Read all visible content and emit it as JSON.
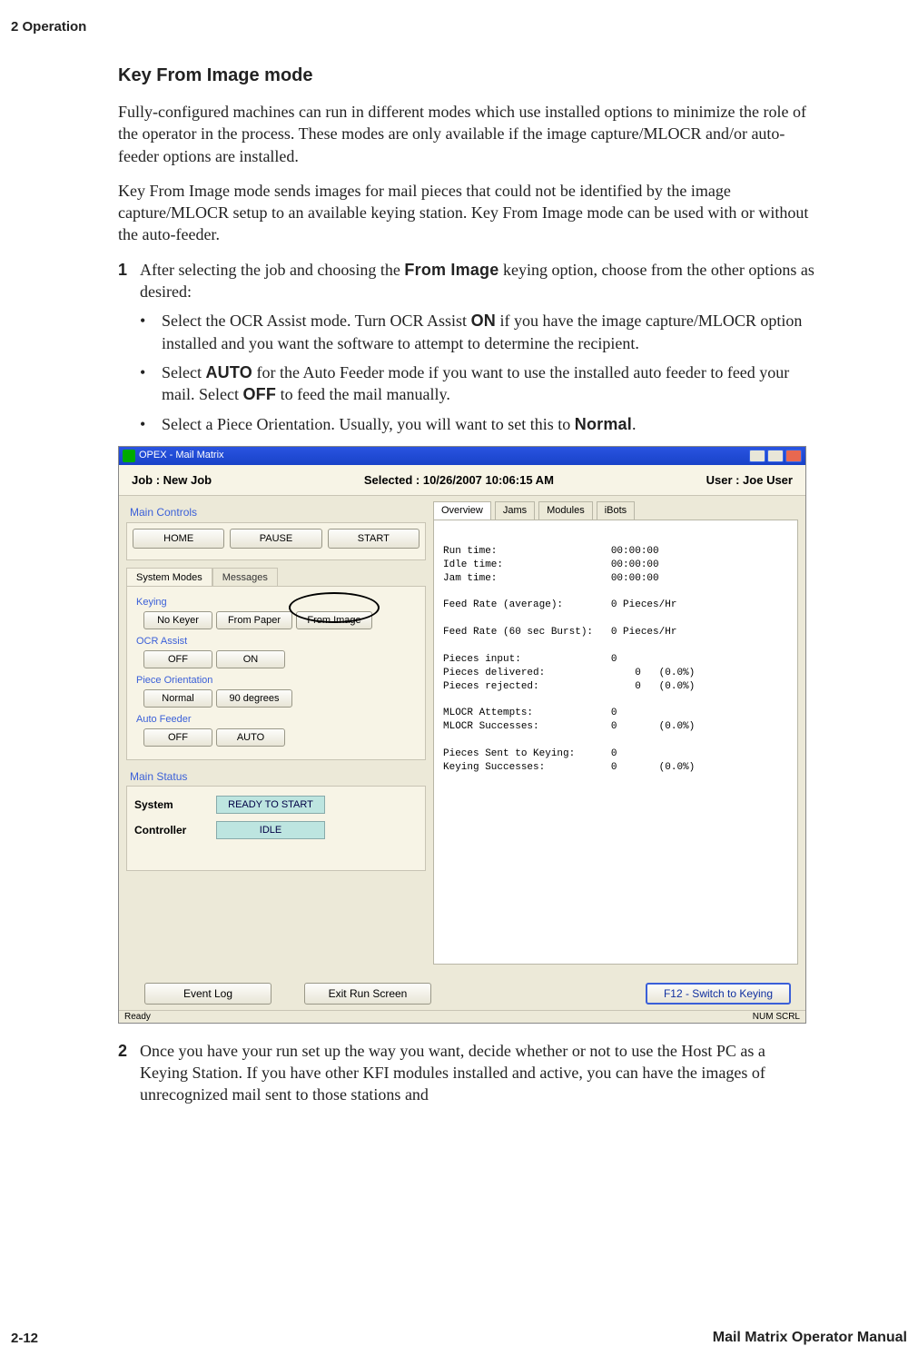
{
  "header": {
    "chapter": "2  Operation"
  },
  "section": {
    "title": "Key From Image mode"
  },
  "p1": "Fully-configured machines can run in different modes which use installed options to minimize the role of the operator in the process. These modes are only available if the image capture/MLOCR and/or auto-feeder options are installed.",
  "p2": "Key From Image mode sends images for mail pieces that could not be identified by the image capture/MLOCR setup to an available keying station. Key From Image mode can be used with or without the auto-feeder.",
  "step1": {
    "num": "1",
    "text_a": "After selecting the job and choosing the ",
    "term_a": "From Image",
    "text_b": " keying option, choose from the other options as desired:"
  },
  "bullets": {
    "b1_a": "Select the OCR Assist mode. Turn OCR Assist ",
    "b1_on": "ON",
    "b1_b": " if you have the image capture/MLOCR option installed and you want the software to attempt to determine the recipient.",
    "b2_a": "Select ",
    "b2_auto": "AUTO",
    "b2_b": " for the Auto Feeder mode if you want to use the installed auto feeder to feed your mail. Select ",
    "b2_off": "OFF",
    "b2_c": " to feed the mail manually.",
    "b3_a": "Select a Piece Orientation. Usually, you will want to set this to ",
    "b3_norm": "Normal",
    "b3_b": "."
  },
  "shot": {
    "title": "OPEX - Mail Matrix",
    "job": "Job : New Job",
    "selected": "Selected : 10/26/2007 10:06:15 AM",
    "user": "User : Joe User",
    "main_controls_label": "Main Controls",
    "btn_home": "HOME",
    "btn_pause": "PAUSE",
    "btn_start": "START",
    "tab_system_modes": "System Modes",
    "tab_messages": "Messages",
    "grp_keying": "Keying",
    "opt_no_keyer": "No Keyer",
    "opt_from_paper": "From Paper",
    "opt_from_image": "From Image",
    "grp_ocr": "OCR Assist",
    "opt_off": "OFF",
    "opt_on": "ON",
    "grp_piece": "Piece Orientation",
    "opt_normal": "Normal",
    "opt_90": "90 degrees",
    "grp_feeder": "Auto Feeder",
    "opt_feeder_off": "OFF",
    "opt_feeder_auto": "AUTO",
    "main_status_label": "Main Status",
    "status_system": "System",
    "status_system_val": "READY TO START",
    "status_controller": "Controller",
    "status_controller_val": "IDLE",
    "btn_event_log": "Event Log",
    "btn_exit_run": "Exit Run Screen",
    "btn_switch": "F12 - Switch to Keying",
    "rtab_overview": "Overview",
    "rtab_jams": "Jams",
    "rtab_modules": "Modules",
    "rtab_ibots": "iBots",
    "statusbar_left": "Ready",
    "statusbar_right": "NUM  SCRL"
  },
  "chart_data": {
    "type": "table",
    "rows": [
      {
        "label": "Run time:",
        "value": "00:00:00"
      },
      {
        "label": "Idle time:",
        "value": "00:00:00"
      },
      {
        "label": "Jam time:",
        "value": "00:00:00"
      },
      {
        "label": "Feed Rate (average):",
        "value": "0 Pieces/Hr"
      },
      {
        "label": "Feed Rate (60 sec Burst):",
        "value": "0 Pieces/Hr"
      },
      {
        "label": "Pieces input:",
        "value": "0"
      },
      {
        "label": "Pieces delivered:",
        "value": "0   (0.0%)"
      },
      {
        "label": "Pieces rejected:",
        "value": "0   (0.0%)"
      },
      {
        "label": "MLOCR Attempts:",
        "value": "0"
      },
      {
        "label": "MLOCR Successes:",
        "value": "0       (0.0%)"
      },
      {
        "label": "Pieces Sent to Keying:",
        "value": "0"
      },
      {
        "label": "Keying Successes:",
        "value": "0       (0.0%)"
      }
    ]
  },
  "step2": {
    "num": "2",
    "text": "Once you have your run set up the way you want, decide whether or not to use the Host PC as a Keying Station. If you have other KFI modules installed and active, you can have the images of unrecognized mail sent to those stations and"
  },
  "footer": {
    "page": "2-12",
    "manual": "Mail Matrix Operator Manual"
  }
}
